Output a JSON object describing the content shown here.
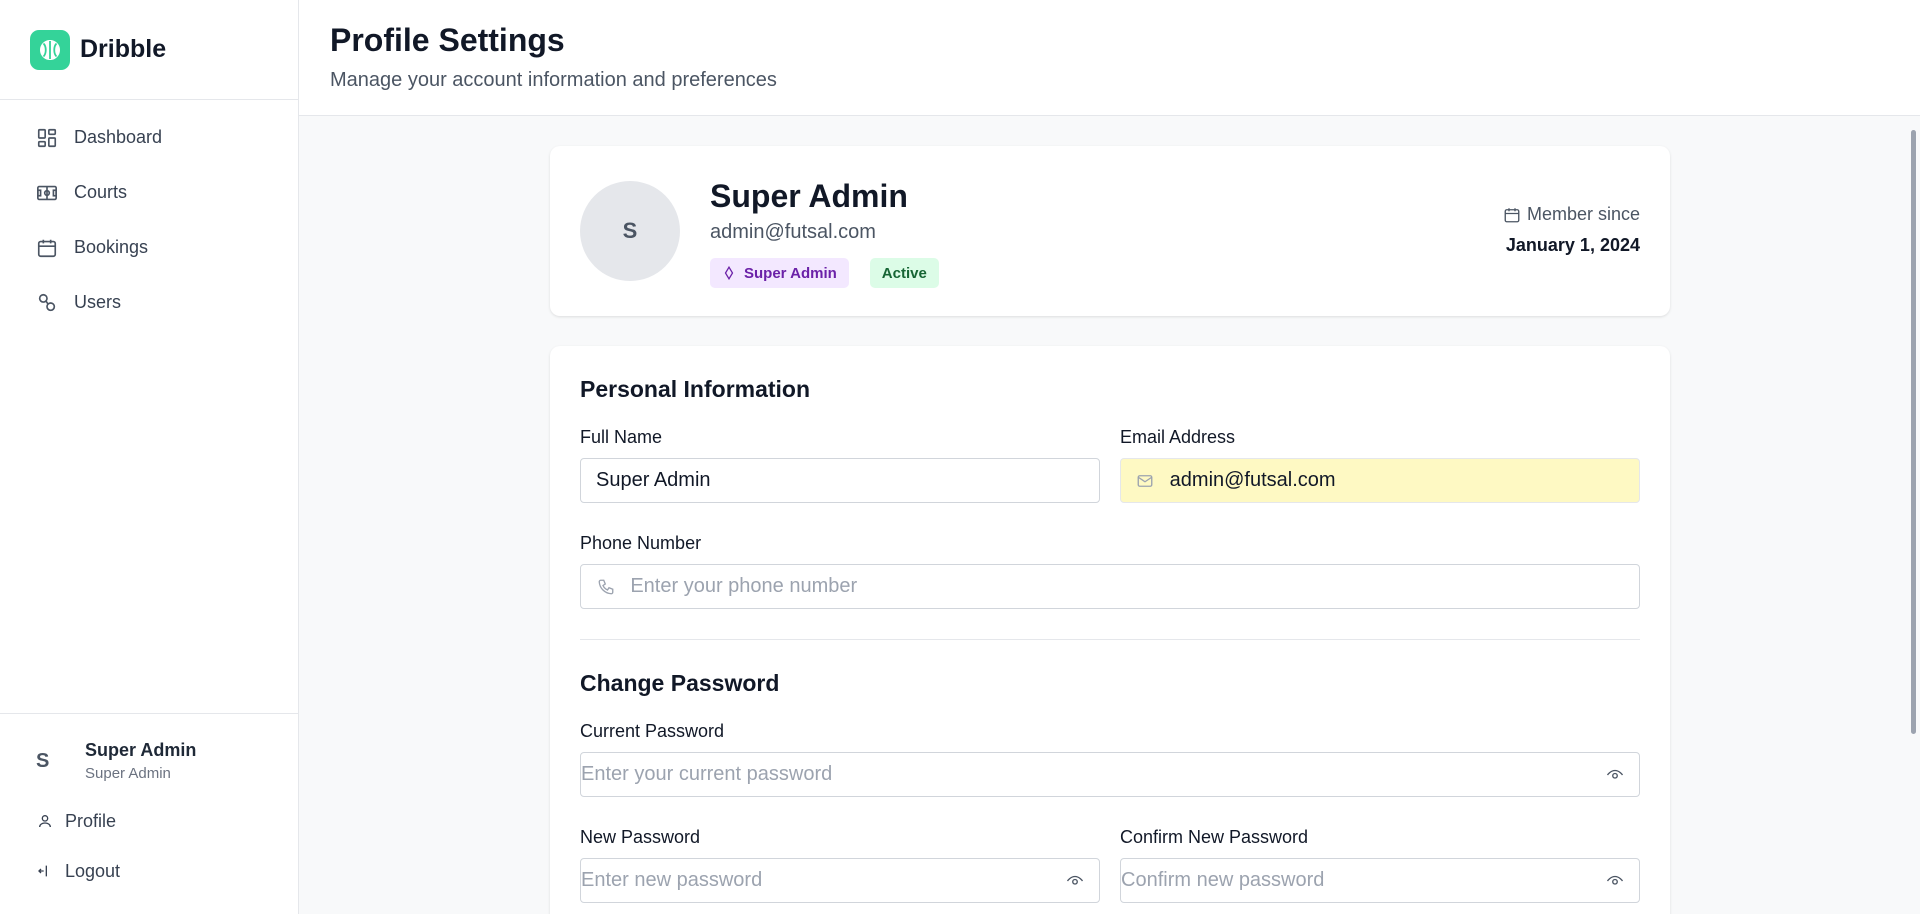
{
  "brand": {
    "name": "Dribble"
  },
  "sidebar": {
    "items": [
      {
        "label": "Dashboard",
        "icon": "dashboard-icon"
      },
      {
        "label": "Courts",
        "icon": "court-icon"
      },
      {
        "label": "Bookings",
        "icon": "calendar-icon"
      },
      {
        "label": "Users",
        "icon": "users-icon"
      }
    ],
    "user": {
      "initial": "S",
      "name": "Super Admin",
      "role": "Super Admin"
    },
    "profile_label": "Profile",
    "logout_label": "Logout"
  },
  "header": {
    "title": "Profile Settings",
    "subtitle": "Manage your account information and preferences"
  },
  "profile": {
    "initial": "S",
    "name": "Super Admin",
    "email": "admin@futsal.com",
    "role_badge": "Super Admin",
    "status_badge": "Active",
    "member_since_label": "Member since",
    "member_since_date": "January 1, 2024"
  },
  "personal_info": {
    "title": "Personal Information",
    "full_name": {
      "label": "Full Name",
      "value": "Super Admin"
    },
    "email": {
      "label": "Email Address",
      "value": "admin@futsal.com"
    },
    "phone": {
      "label": "Phone Number",
      "placeholder": "Enter your phone number"
    }
  },
  "password": {
    "title": "Change Password",
    "current": {
      "label": "Current Password",
      "placeholder": "Enter your current password"
    },
    "new": {
      "label": "New Password",
      "placeholder": "Enter new password"
    },
    "confirm": {
      "label": "Confirm New Password",
      "placeholder": "Confirm new password"
    }
  },
  "colors": {
    "brand_green": "#34d399",
    "role_badge_bg": "#f3e8ff",
    "role_badge_text": "#6b21a8",
    "status_badge_bg": "#dcfce7",
    "status_badge_text": "#166534",
    "autofill_bg": "#fef9c3"
  }
}
